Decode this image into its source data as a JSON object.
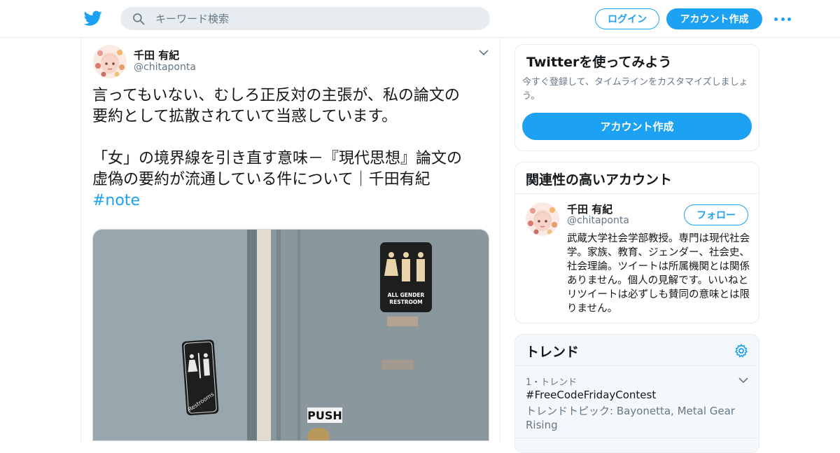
{
  "header": {
    "search_placeholder": "キーワード検索",
    "login_label": "ログイン",
    "signup_label": "アカウント作成",
    "logo_icon": "twitter-bird-icon",
    "brand_color": "#1da1f2"
  },
  "tweet": {
    "author_name": "千田 有紀",
    "author_handle": "@chitaponta",
    "lines": [
      "言ってもいない、むしろ正反対の主張が、私の論文の",
      "要約として拡散されていて当惑しています。",
      "「女」の境界線を引き直す意味－『現代思想』論文の",
      "虚偽の要約が流通している件について｜千田有紀"
    ],
    "hashtag": "#note",
    "media": {
      "sign_left": "Restrooms",
      "sign_right_line1": "ALL GENDER",
      "sign_right_line2": "RESTROOM",
      "door_label": "PUSH"
    }
  },
  "sidebar": {
    "try_card": {
      "title": "Twitterを使ってみよう",
      "subtitle": "今すぐ登録して、タイムラインをカスタマイズしましょう。",
      "button_label": "アカウント作成"
    },
    "related_card": {
      "title": "関連性の高いアカウント",
      "name": "千田 有紀",
      "handle": "@chitaponta",
      "follow_label": "フォロー",
      "bio": "武蔵大学社会学部教授。専門は現代社会学。家族、教育、ジェンダー、社会史、社会理論。ツイートは所属機関とは関係ありません。個人の見解です。いいねとリツイートは必ずしも賛同の意味とは限りません。"
    },
    "trends_card": {
      "title": "トレンド",
      "items": [
        {
          "rank": "1・トレンド",
          "name": "#FreeCodeFridayContest",
          "topic": "トレンドトピック: Bayonetta, Metal Gear Rising"
        }
      ]
    }
  }
}
